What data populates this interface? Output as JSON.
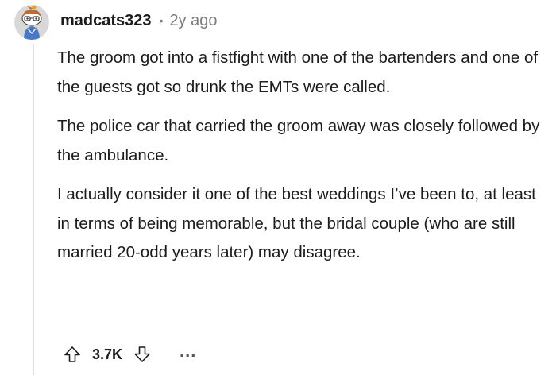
{
  "comment": {
    "author": "madcats323",
    "separator": "•",
    "age": "2y ago",
    "paragraphs": [
      "The groom got into a fistfight with one of the bartenders and one of the guests got so drunk the EMTs were called.",
      "The police car that carried the groom away was closely followed by the ambulance.",
      "I actually consider it one of the best weddings I’ve been to, at least in terms of being memorable, but the bridal couple (who are still married 20-odd years later) may disagree."
    ],
    "score": "3.7K",
    "more_label": "..."
  },
  "icons": {
    "avatar": "snoo-avatar",
    "upvote": "upvote-arrow-icon",
    "downvote": "downvote-arrow-icon",
    "more": "ellipsis-icon"
  },
  "colors": {
    "text": "#1c1c1c",
    "meta": "#7c7c7c",
    "thread_line": "#e0e0e0"
  }
}
